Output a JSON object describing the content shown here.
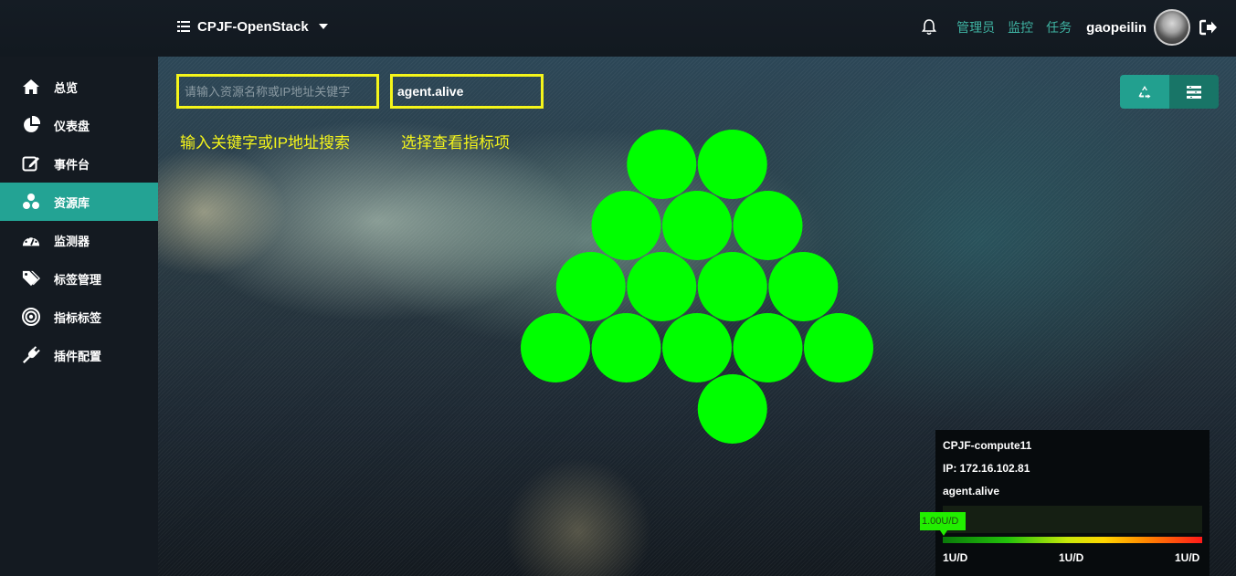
{
  "header": {
    "project_name": "CPJF-OpenStack",
    "links": [
      "管理员",
      "监控",
      "任务"
    ],
    "username": "gaopeilin",
    "accent_color": "#3fb4a3"
  },
  "sidebar": {
    "active_color": "#23a394",
    "items": [
      {
        "label": "总览",
        "icon": "home-icon"
      },
      {
        "label": "仪表盘",
        "icon": "pie-chart-icon"
      },
      {
        "label": "事件台",
        "icon": "edit-icon"
      },
      {
        "label": "资源库",
        "icon": "cubes-icon",
        "active": true
      },
      {
        "label": "监测器",
        "icon": "dashboard-gauge-icon"
      },
      {
        "label": "标签管理",
        "icon": "tags-icon"
      },
      {
        "label": "指标标签",
        "icon": "bullseye-icon"
      },
      {
        "label": "插件配置",
        "icon": "plug-icon"
      }
    ]
  },
  "main": {
    "search_placeholder": "请输入资源名称或IP地址关键字",
    "metric_selected": "agent.alive",
    "hint_search": "输入关键字或IP地址搜索",
    "hint_metric": "选择查看指标项",
    "highlight_color": "#f5f51a",
    "hex_color": "#00ff00",
    "hex_rows": [
      2,
      3,
      4,
      5,
      1
    ],
    "hex_count": 15
  },
  "tooltip": {
    "host": "CPJF-compute11",
    "ip": "IP: 172.16.102.81",
    "metric": "agent.alive",
    "value_label": "1.00U/D",
    "scale_labels": [
      "1U/D",
      "1U/D",
      "1U/D"
    ]
  }
}
